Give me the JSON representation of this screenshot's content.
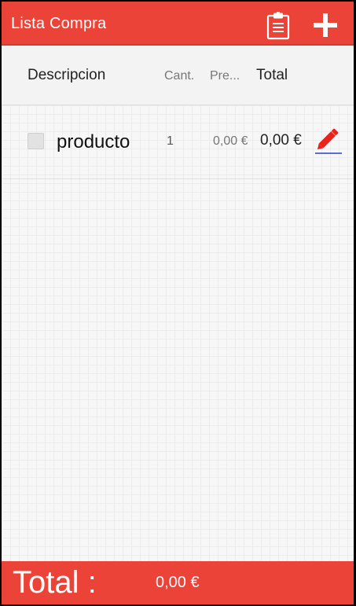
{
  "appbar": {
    "title": "Lista Compra",
    "icons": {
      "clipboard": "clipboard-icon",
      "add": "plus-icon"
    }
  },
  "columns": {
    "description": "Descripcion",
    "quantity": "Cant.",
    "price": "Pre...",
    "total": "Total"
  },
  "items": [
    {
      "checked": false,
      "name": "producto",
      "quantity": "1",
      "price": "0,00 €",
      "total": "0,00 €",
      "edit_icon": "pencil-icon"
    }
  ],
  "footer": {
    "label": "Total :",
    "value": "0,00 €"
  },
  "colors": {
    "accent": "#eb4338",
    "edit_pencil": "#e8231c",
    "edit_underline": "#2b3fcf"
  }
}
